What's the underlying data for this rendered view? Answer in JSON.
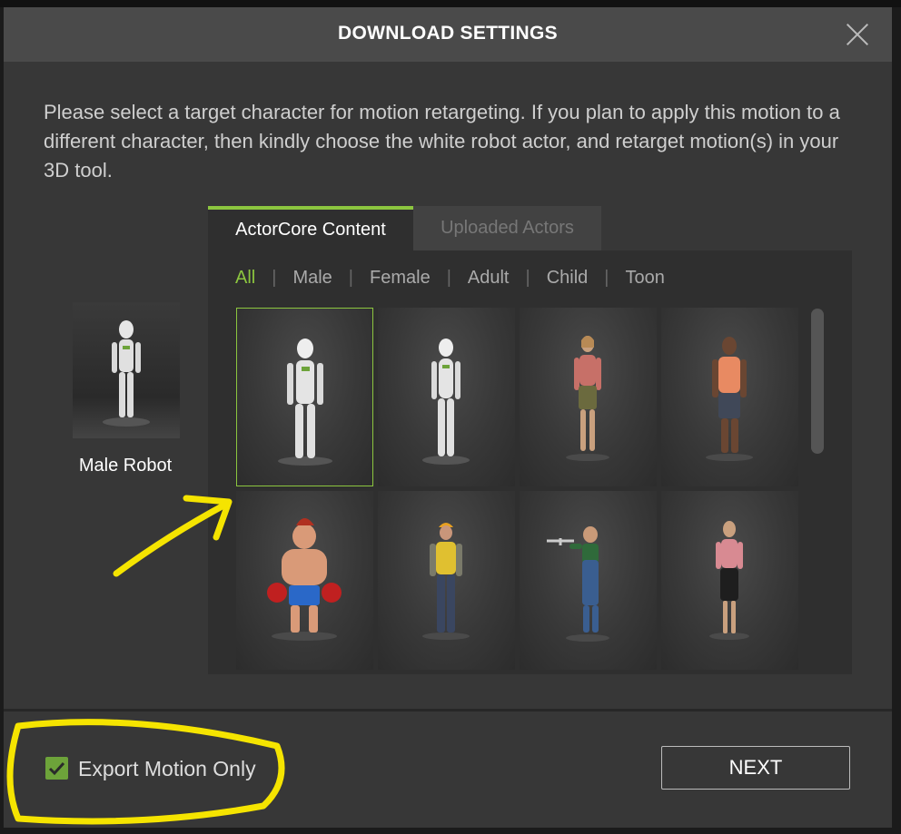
{
  "dialog": {
    "title": "DOWNLOAD SETTINGS",
    "instructions": "Please select a target character for motion retargeting. If you plan to apply this motion to a different character, then kindly choose the white robot actor, and retarget motion(s) in your 3D tool.",
    "close_icon": "close-icon"
  },
  "selected_character": {
    "name": "Male Robot"
  },
  "tabs": [
    {
      "label": "ActorCore Content",
      "active": true
    },
    {
      "label": "Uploaded Actors",
      "active": false
    }
  ],
  "filters": [
    {
      "label": "All",
      "active": true
    },
    {
      "label": "Male",
      "active": false
    },
    {
      "label": "Female",
      "active": false
    },
    {
      "label": "Adult",
      "active": false
    },
    {
      "label": "Child",
      "active": false
    },
    {
      "label": "Toon",
      "active": false
    }
  ],
  "characters": [
    {
      "kind": "robot-male",
      "selected": true
    },
    {
      "kind": "robot-female",
      "selected": false
    },
    {
      "kind": "woman-pink-top",
      "selected": false
    },
    {
      "kind": "man-orange-shirt",
      "selected": false
    },
    {
      "kind": "cartoon-boxer",
      "selected": false
    },
    {
      "kind": "construction-worker",
      "selected": false
    },
    {
      "kind": "boy-with-plane",
      "selected": false
    },
    {
      "kind": "woman-pink-blouse",
      "selected": false
    }
  ],
  "export_option": {
    "label": "Export Motion Only",
    "checked": true
  },
  "next_button": {
    "label": "NEXT"
  },
  "colors": {
    "accent": "#8cc63f",
    "checkbox": "#6da33a",
    "annotation": "#f5e400"
  }
}
